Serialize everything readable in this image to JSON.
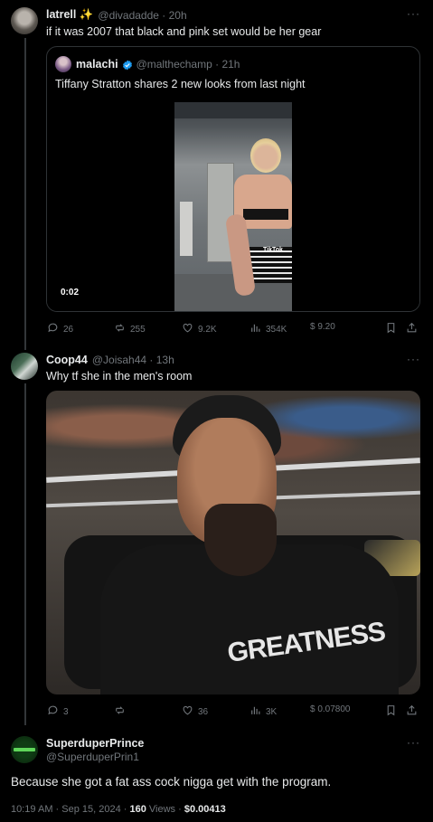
{
  "tweet1": {
    "name": "latrell ✨",
    "handle": "@divadadde · 20h",
    "text": "if it was 2007 that black and pink set would be her gear",
    "quote": {
      "name": "malachi",
      "handle": "@malthechamp · 21h",
      "text": "Tiffany Stratton shares 2 new looks from last night",
      "video_time": "0:02",
      "tiktok_label": "TikTok"
    },
    "actions": {
      "replies": "26",
      "reposts": "255",
      "likes": "9.2K",
      "views": "354K",
      "tips": "$ 9.20"
    }
  },
  "tweet2": {
    "name": "Coop44",
    "handle": "@Joisah44 · 13h",
    "text": "Why tf she in the men's room",
    "shirt_text": "GREATNESS",
    "actions": {
      "replies": "3",
      "reposts": "",
      "likes": "36",
      "views": "3K",
      "tips": "$ 0.07800"
    }
  },
  "tweet3": {
    "name": "SuperduperPrince",
    "handle": "@SuperduperPrin1",
    "text": "Because she got a fat ass cock nigga get with the program.",
    "timestamp": "10:19 AM · Sep 15, 2024 · ",
    "views_count": "160",
    "views_label": " Views · ",
    "tip_amount": "$0.00413"
  },
  "colors": {
    "background": "#000000",
    "text": "#e7e9ea",
    "secondary": "#71767b",
    "verified": "#1d9bf0",
    "border": "#2f3336"
  },
  "icons": [
    "more-icon",
    "verified-icon",
    "reply-icon",
    "repost-icon",
    "like-icon",
    "views-icon",
    "tip-icon",
    "bookmark-icon",
    "share-icon"
  ]
}
